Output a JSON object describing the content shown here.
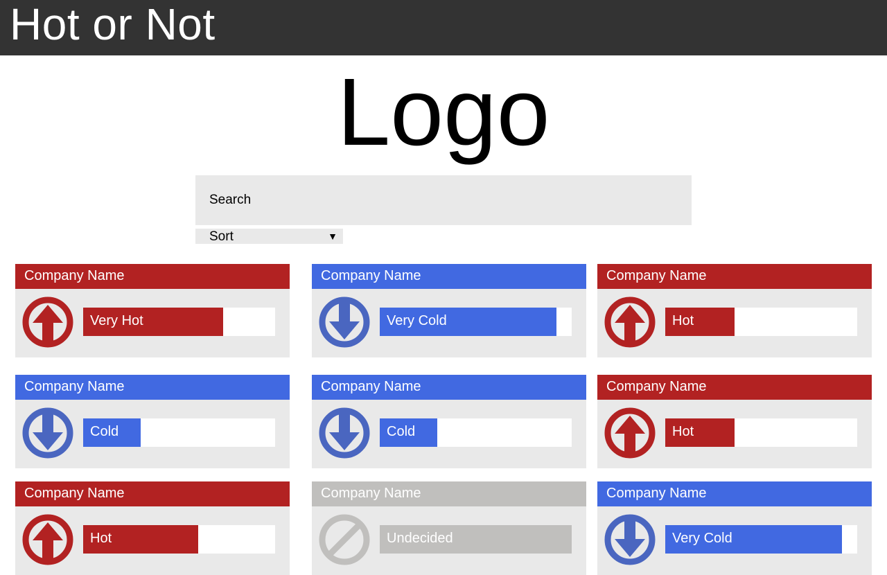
{
  "app": {
    "title": "Hot or Not"
  },
  "logo": {
    "text": "Logo"
  },
  "search": {
    "placeholder": "Search"
  },
  "sort": {
    "label": "Sort",
    "caret": "▼"
  },
  "colors": {
    "hot": "#b22222",
    "cold": "#4169e1",
    "cold_icon": "#4a66c0",
    "undecided": "#c0bfbd",
    "card_bg": "#e9e9e9",
    "topbar": "#333333"
  },
  "cards": [
    {
      "name": "Company Name",
      "rating": "Very Hot",
      "kind": "hot",
      "fill": 0.73,
      "icon": "arrow-up-icon"
    },
    {
      "name": "Company Name",
      "rating": "Very Cold",
      "kind": "cold",
      "fill": 0.92,
      "icon": "arrow-down-icon"
    },
    {
      "name": "Company Name",
      "rating": "Hot",
      "kind": "hot",
      "fill": 0.36,
      "icon": "arrow-up-icon"
    },
    {
      "name": "Company Name",
      "rating": "Cold",
      "kind": "cold",
      "fill": 0.3,
      "icon": "arrow-down-icon"
    },
    {
      "name": "Company Name",
      "rating": "Cold",
      "kind": "cold",
      "fill": 0.3,
      "icon": "arrow-down-icon"
    },
    {
      "name": "Company Name",
      "rating": "Hot",
      "kind": "hot",
      "fill": 0.36,
      "icon": "arrow-up-icon"
    },
    {
      "name": "Company Name",
      "rating": "Hot",
      "kind": "hot",
      "fill": 0.6,
      "icon": "arrow-up-icon"
    },
    {
      "name": "Company Name",
      "rating": "Undecided",
      "kind": "undecided",
      "fill": 1.0,
      "icon": "no-entry-icon"
    },
    {
      "name": "Company Name",
      "rating": "Very Cold",
      "kind": "cold",
      "fill": 0.92,
      "icon": "arrow-down-icon"
    }
  ]
}
